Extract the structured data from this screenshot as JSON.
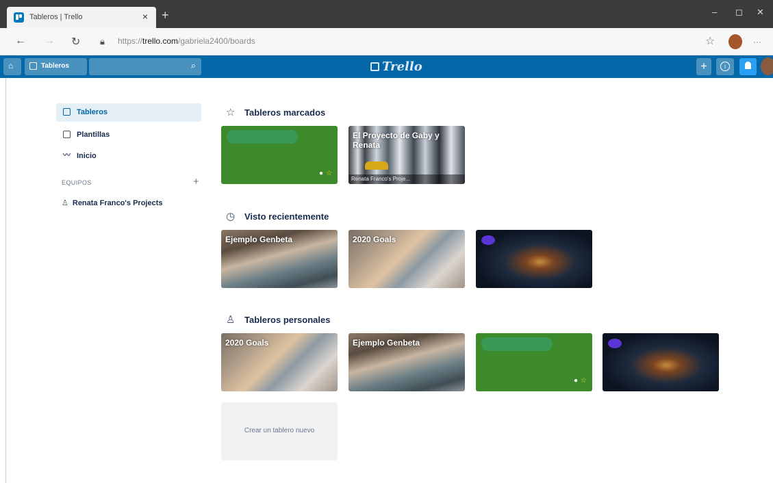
{
  "browser": {
    "tab_title": "Tableros | Trello",
    "tab_close": "×",
    "new_tab": "+",
    "url_prefix": "https://",
    "url_domain": "trello.com",
    "url_path": "/gabriela2400/boards",
    "minimize": "–",
    "maximize": "◻",
    "close": "✕",
    "more": "···"
  },
  "header": {
    "boards_button": "Tableros",
    "logo": "Trello",
    "search_icon": "search-icon",
    "add_label": "+",
    "info_label": "i",
    "bell_label": "🔔"
  },
  "sidebar": {
    "items": [
      {
        "label": "Tableros",
        "icon": "board-icon",
        "active": true
      },
      {
        "label": "Plantillas",
        "icon": "template-icon",
        "active": false
      },
      {
        "label": "Inicio",
        "icon": "activity-icon",
        "active": false
      }
    ],
    "teams_heading": "EQUIPOS",
    "teams_add": "+",
    "team_name": "Renata Franco's Projects"
  },
  "sections": {
    "starred_title": "Tableros marcados",
    "recent_title": "Visto recientemente",
    "personal_title": "Tableros personales"
  },
  "boards": {
    "starred": [
      {
        "title": "",
        "bg": "green"
      },
      {
        "title": "El Proyecto de Gaby y Renata",
        "subtitle": "Renata Franco's Proje...",
        "bg": "books"
      }
    ],
    "recent": [
      {
        "title": "Ejemplo Genbeta",
        "bg": "rock"
      },
      {
        "title": "2020 Goals",
        "bg": "cat"
      },
      {
        "title": "",
        "bg": "space"
      }
    ],
    "personal": [
      {
        "title": "2020 Goals",
        "bg": "cat"
      },
      {
        "title": "Ejemplo Genbeta",
        "bg": "rock"
      },
      {
        "title": "",
        "bg": "green"
      },
      {
        "title": "",
        "bg": "space"
      }
    ]
  },
  "create_board": "Crear un tablero nuevo",
  "colors": {
    "header": "#0468a8",
    "sidebar_active": "#e4f0f6",
    "green_board": "#3d8a2d"
  }
}
